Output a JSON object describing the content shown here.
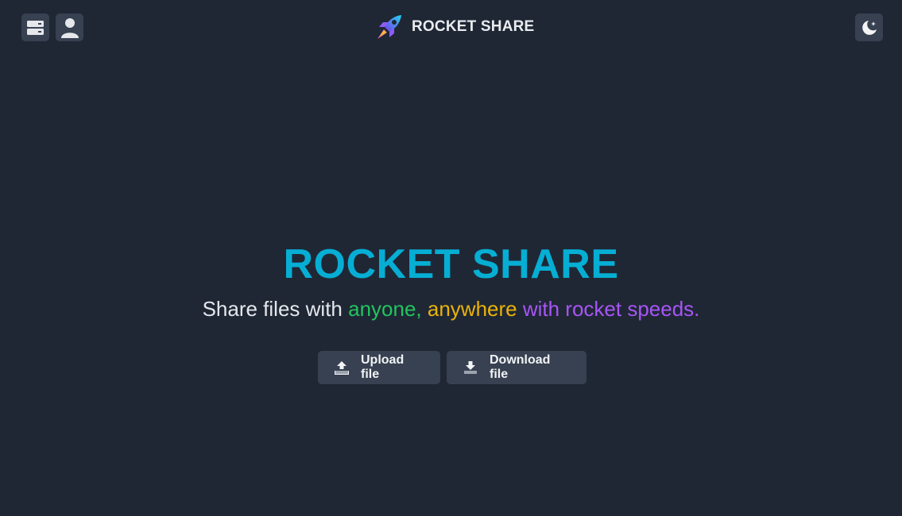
{
  "header": {
    "brand_name": "ROCKET SHARE",
    "left_icons": [
      "server-icon",
      "user-icon"
    ],
    "right_icons": [
      "moon-stars-icon"
    ]
  },
  "hero": {
    "title": "ROCKET SHARE",
    "tagline": {
      "part1": "Share files with ",
      "part2": "anyone,",
      "part3": " ",
      "part4": "anywhere",
      "part5": " ",
      "part6": "with rocket speeds."
    }
  },
  "actions": {
    "upload_label": "Upload file",
    "download_label": "Download file"
  },
  "colors": {
    "background": "#1f2735",
    "button": "#374151",
    "title": "#06aed4",
    "green": "#22c55e",
    "amber": "#eab308",
    "purple": "#a855f7"
  }
}
